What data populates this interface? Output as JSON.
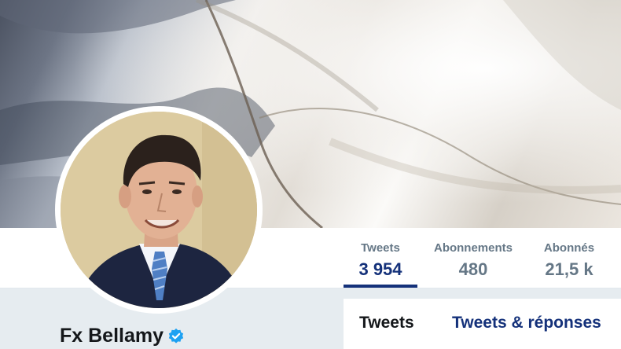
{
  "profile": {
    "name": "Fx Bellamy",
    "verified": true
  },
  "stats": [
    {
      "label": "Tweets",
      "value": "3 954"
    },
    {
      "label": "Abonnements",
      "value": "480"
    },
    {
      "label": "Abonnés",
      "value": "21,5 k"
    }
  ],
  "tabs": [
    {
      "label": "Tweets"
    },
    {
      "label": "Tweets & réponses"
    }
  ],
  "colors": {
    "accent": "#14317a",
    "muted": "#657786",
    "verified": "#1da1f2",
    "background": "#e6ecf0"
  },
  "icons": {
    "verified": "verified-badge-icon"
  }
}
